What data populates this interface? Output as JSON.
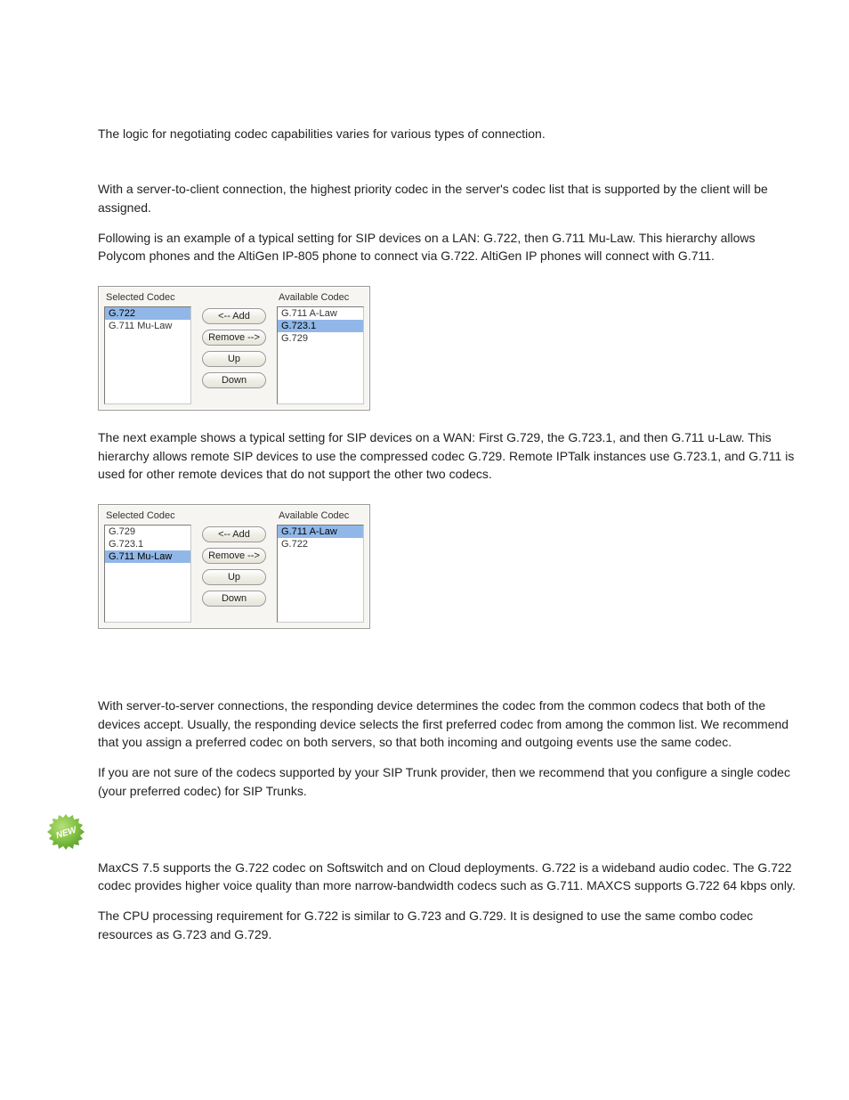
{
  "intro": "The logic for negotiating codec capabilities varies for various types of connection.",
  "p1": "With a server-to-client connection, the highest priority codec in the server's codec list that is supported by the client will be assigned.",
  "p2": "Following is an example of a typical setting for SIP devices on a LAN: G.722, then G.711 Mu-Law. This hierarchy allows Polycom phones and the AltiGen IP-805 phone to connect via G.722. AltiGen IP phones will connect with G.711.",
  "panel1": {
    "selected_label": "Selected Codec",
    "available_label": "Available Codec",
    "selected": [
      "G.722",
      "G.711 Mu-Law"
    ],
    "available": [
      "G.711 A-Law",
      "G.723.1",
      "G.729"
    ],
    "selected_hl_index": 0,
    "available_hl_index": 1,
    "buttons": {
      "add": "<-- Add",
      "remove": "Remove -->",
      "up": "Up",
      "down": "Down"
    }
  },
  "p3": "The next example shows a typical setting for SIP devices on a WAN: First G.729, the G.723.1, and then G.711 u-Law. This hierarchy allows remote SIP devices to use the compressed codec G.729. Remote IPTalk instances use G.723.1, and G.711 is used for other remote devices that do not support the other two codecs.",
  "panel2": {
    "selected_label": "Selected Codec",
    "available_label": "Available Codec",
    "selected": [
      "G.729",
      "G.723.1",
      "G.711 Mu-Law"
    ],
    "available": [
      "G.711 A-Law",
      "G.722"
    ],
    "selected_hl_index": 2,
    "available_hl_index": 0,
    "buttons": {
      "add": "<-- Add",
      "remove": "Remove -->",
      "up": "Up",
      "down": "Down"
    }
  },
  "p4": "With server-to-server connections, the responding device determines the codec from the common codecs that both of the devices accept. Usually, the responding device selects the first preferred codec from among the common list. We recommend that you assign a preferred codec on both servers, so that both incoming and outgoing events use the same codec.",
  "p5": "If you are not sure of the codecs supported by your SIP Trunk provider, then we recommend that you configure a single codec (your preferred codec) for SIP Trunks.",
  "p6": "MaxCS 7.5 supports the G.722 codec on Softswitch and on Cloud deployments. G.722 is a wideband audio codec. The G.722 codec provides higher voice quality than more narrow-bandwidth codecs such as G.711. MAXCS supports G.722 64 kbps only.",
  "p7": "The CPU processing requirement for G.722 is similar to G.723 and G.729. It is designed to use the same combo codec resources as G.723 and G.729.",
  "badge_text": "NEW"
}
